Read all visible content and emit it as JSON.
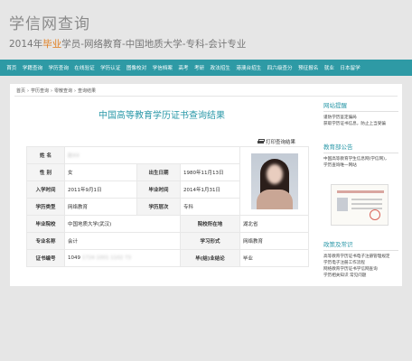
{
  "header": {
    "site_title": "学信网查询",
    "subtitle_prefix": "2014年",
    "subtitle_highlight": "毕业",
    "subtitle_rest": "学员-网络教育-中国地质大学-专科-会计专业"
  },
  "nav": [
    "首页",
    "学籍查询",
    "学历查询",
    "在线验证",
    "学历认证",
    "图像校对",
    "学信档案",
    "高考",
    "考研",
    "政法招生",
    "港澳台招生",
    "四六级查分",
    "预征报名",
    "就业",
    "日本留学"
  ],
  "breadcrumb": [
    "首页",
    "学历查询",
    "零散查询",
    "查询结果"
  ],
  "result_title": "中国高等教育学历证书查询结果",
  "print_label": "打印查询结果",
  "record": {
    "name_label": "姓 名",
    "name_value": "赵XX",
    "gender_label": "性 别",
    "gender_value": "女",
    "birth_label": "出生日期",
    "birth_value": "1980年11月13日",
    "enroll_label": "入学时间",
    "enroll_value": "2011年9月1日",
    "grad_label": "毕业时间",
    "grad_value": "2014年1月31日",
    "type_label": "学历类型",
    "type_value": "网络教育",
    "level_label": "学历层次",
    "level_value": "专科",
    "school_label": "毕业院校",
    "school_value": "中国地质大学(武汉)",
    "location_label": "院校所在地",
    "location_value": "湖北省",
    "major_label": "专业名称",
    "major_value": "会计",
    "mode_label": "学习形式",
    "mode_value": "网络教育",
    "cert_label": "证书编号",
    "cert_prefix": "1049",
    "cert_rest": "1724 1001 1102 73",
    "conclusion_label": "毕(结)业结论",
    "conclusion_value": "毕业"
  },
  "sidebar": {
    "section1_title": "网站提醒",
    "section1_lines": [
      "谨防学历鉴定骗局",
      "获取学历证书信息，防止上当受骗"
    ],
    "section2_title": "教育部公告",
    "section2_lines": [
      "中国高等教育学生信息网(学信网)，",
      "学历查询唯一网站"
    ],
    "section3_title": "政策及常识",
    "section3_lines": [
      "高等教育学历证书电子注册管理规定",
      "学历电子注册工作流程",
      "网络教育学历证书学信网查询",
      "学历相关知识  常见问题"
    ]
  }
}
